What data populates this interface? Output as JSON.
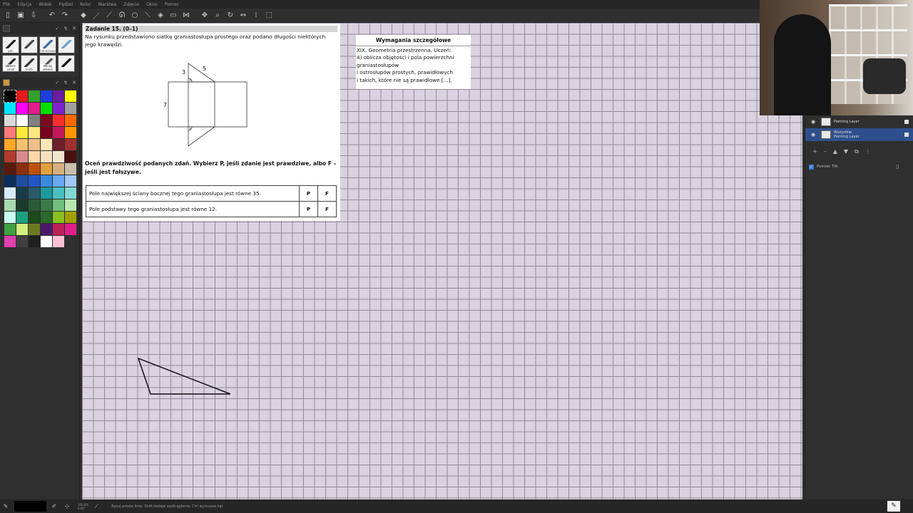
{
  "menu": [
    "Plik",
    "Edycja",
    "Widok",
    "Pędzel",
    "Kolor",
    "Warstwa",
    "Zdjęcie",
    "Okno",
    "Pomoc"
  ],
  "toolbar": {
    "icons": [
      "new-file-icon",
      "save-icon",
      "export-icon",
      "undo-icon",
      "redo-icon",
      "eraser-icon",
      "pen-icon",
      "ruler-icon",
      "lasso-icon",
      "ellipse-icon",
      "eyedropper-icon",
      "fill-icon",
      "rect-select-icon",
      "symmetry-icon",
      "move-icon",
      "zoom-icon",
      "rotate-icon",
      "flip-icon",
      "info-icon",
      "select-icon"
    ]
  },
  "brushes": [
    {
      "label": "pen",
      "icon": "pen-brush-icon"
    },
    {
      "label": "",
      "icon": "pencil-brush-icon"
    },
    {
      "label": "ink-ecosue",
      "icon": "ink-brush-icon"
    },
    {
      "label": "",
      "icon": "airbrush-icon"
    },
    {
      "label": "marker-small",
      "icon": "marker-brush-icon"
    },
    {
      "label": "knife",
      "icon": "knife-brush-icon"
    },
    {
      "label": "okrąg ołówek",
      "icon": "round-pencil-brush-icon"
    },
    {
      "label": "",
      "icon": "smudge-brush-icon"
    }
  ],
  "palette": [
    "#000000",
    "#e31a1c",
    "#33a02c",
    "#1f3ee0",
    "#6a1fa0",
    "#ffff00",
    "#00e5ff",
    "#ff00ff",
    "#e01e8c",
    "#00e000",
    "#7e22ce",
    "#a0a0a0",
    "#d9d9d9",
    "#ffffff",
    "#808080",
    "#7b0c1c",
    "#ff2d2d",
    "#ff6a00",
    "#ff7a7a",
    "#ffea3b",
    "#ffe680",
    "#7a001d",
    "#c2185b",
    "#ff9800",
    "#ffa726",
    "#f5c16c",
    "#f0c088",
    "#ffe4b5",
    "#6d1f2a",
    "#a0312f",
    "#b03a2e",
    "#d98b8b",
    "#ffd7a8",
    "#f7e0c0",
    "#f2e6d0",
    "#4a1010",
    "#5a1a0a",
    "#8a3010",
    "#c05010",
    "#e0a040",
    "#d6b080",
    "#c8c0a8",
    "#0b2d5a",
    "#1f4e9c",
    "#2456c7",
    "#3a8ae0",
    "#6aa8f0",
    "#a0c8f8",
    "#d8ecff",
    "#1a3a4a",
    "#2a5a6a",
    "#1a9a9a",
    "#4ac0c0",
    "#80d8d0",
    "#a8d8b0",
    "#1a3a2a",
    "#2a5a3a",
    "#3a7a4a",
    "#70c080",
    "#b8e8b0",
    "#c8fff0",
    "#1aa080",
    "#1a4a1a",
    "#2a6a2a",
    "#8ac020",
    "#a0a000",
    "#40a040",
    "#d0f080",
    "#6a7a20",
    "#4a1a6a",
    "#c0205a",
    "#e0208a",
    "#e040b0",
    "#404040",
    "#202020",
    "#ffffff",
    "#ffc0d0",
    ""
  ],
  "sheet": {
    "title": "Zadanie 15. (0–1)",
    "text": "Na rysunku przedstawiono siatkę graniastosłupa prostego oraz podano długości niektórych jego krawędzi.",
    "labels": {
      "a": "3",
      "b": "5",
      "c": "7"
    },
    "question": "Oceń prawdziwość podanych zdań. Wybierz P, jeśli zdanie jest prawdziwe, albo F – jeśli jest fałszywe.",
    "statements": [
      {
        "text": "Pole największej ściany bocznej tego graniastosłupa jest równe 35.",
        "p": "P",
        "f": "F"
      },
      {
        "text": "Pole podstawy tego graniastosłupa jest równe 12.",
        "p": "P",
        "f": "F"
      }
    ]
  },
  "requirements": {
    "title": "Wymagania szczegółowe",
    "lines": [
      "XIX. Geometria przestrzenna. Uczeń:",
      "4) oblicza objętości i pola powierzchni",
      "graniastosłupów",
      "i ostrosłupów prostych, prawidłowych",
      "i takich, które nie są prawidłowe […]."
    ]
  },
  "layers": [
    {
      "name": "",
      "sub": "Painting Layer",
      "selected": false
    },
    {
      "name": "Wszystkie",
      "sub": "Painting Layer",
      "selected": true
    }
  ],
  "layer_buttons": [
    "+",
    "–",
    "▲",
    "▼",
    "⧉",
    "⋮"
  ],
  "pointer": {
    "label": "Pointer Tilt",
    "checked": true
  },
  "status": {
    "zoom": "100.0%",
    "angle": "0.00°",
    "hint": "Rysuj proste linie; Shift dodaje zaokrąglenia; Ctrl wymusza kąt"
  },
  "colors": {
    "canvas": "#d9d2df",
    "grid": "#8f8c97",
    "selection": "#2e4f8c",
    "dark": "#2f2f2f"
  }
}
